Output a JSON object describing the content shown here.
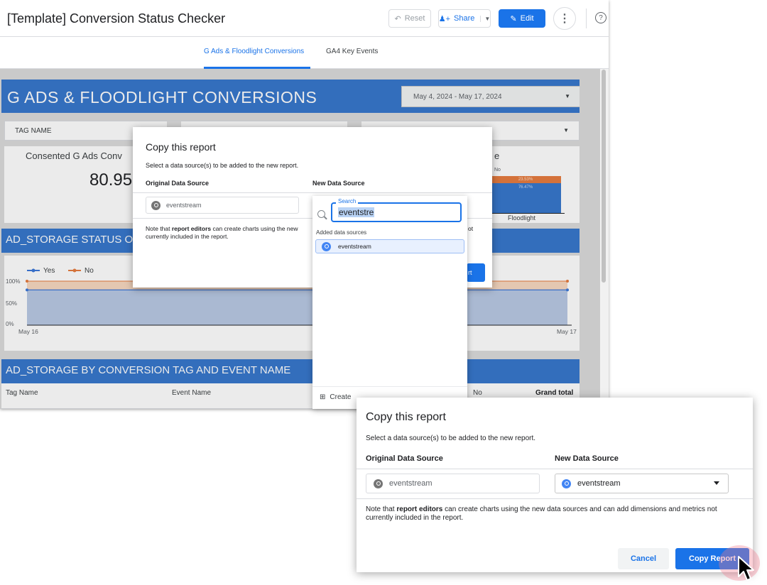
{
  "app": {
    "title": "[Template] Conversion Status Checker",
    "reset_label": "Reset",
    "share_label": "Share",
    "edit_label": "Edit",
    "tabs": [
      {
        "label": "G Ads & Floodlight Conversions",
        "active": true
      },
      {
        "label": "GA4 Key Events",
        "active": false
      }
    ]
  },
  "report": {
    "section1_title": "G ADS & FLOODLIGHT CONVERSIONS",
    "date_range": "May 4, 2024 - May 17, 2024",
    "filter_label": "TAG NAME",
    "scorecard_label": "Consented G Ads Conv",
    "scorecard_value": "80.95",
    "bar_card_title": "e",
    "bar_legend_no": "No",
    "bar_no_value": "23.53%",
    "bar_yes_value": "76.47%",
    "bar_category": "Floodlight",
    "section2_title": "AD_STORAGE STATUS OV",
    "line_legend": [
      {
        "name": "Yes",
        "color": "#3c78d8"
      },
      {
        "name": "No",
        "color": "#e67c3f"
      }
    ],
    "section3_title": "AD_STORAGE BY CONVERSION TAG AND EVENT NAME",
    "table_headers": [
      "Tag Name",
      "Event Name",
      "No",
      "Grand total"
    ]
  },
  "chart_data": {
    "type": "area",
    "x": [
      "May 16",
      "May 17"
    ],
    "y_ticks": [
      "0%",
      "50%",
      "100%"
    ],
    "ylim": [
      0,
      100
    ],
    "series": [
      {
        "name": "Yes",
        "values": [
          80,
          80
        ]
      },
      {
        "name": "No",
        "values": [
          100,
          100
        ]
      }
    ]
  },
  "small_dialog": {
    "title": "Copy this report",
    "subtitle": "Select a data source(s) to be added to the new report.",
    "original_header": "Original Data Source",
    "new_header": "New Data Source",
    "original_source": "eventstream",
    "note_prefix": "Note that ",
    "note_bold": "report editors",
    "note_suffix": " can create charts using the new",
    "note_line2": "currently included in the report.",
    "note_tail": "ot",
    "copy_button_partial": "rt"
  },
  "dropdown": {
    "search_label": "Search",
    "search_value": "eventstre",
    "added_header": "Added data sources",
    "items": [
      "eventstream"
    ],
    "create_label": "Create"
  },
  "main_dialog": {
    "title": "Copy this report",
    "subtitle": "Select a data source(s) to be added to the new report.",
    "original_header": "Original Data Source",
    "new_header": "New Data Source",
    "original_source": "eventstream",
    "new_source": "eventstream",
    "note_prefix": "Note that ",
    "note_bold": "report editors",
    "note_suffix": " can create charts using the new data sources and can add dimensions and metrics not",
    "note_line2": "currently included in the report.",
    "cancel_label": "Cancel",
    "copy_label": "Copy Report"
  }
}
